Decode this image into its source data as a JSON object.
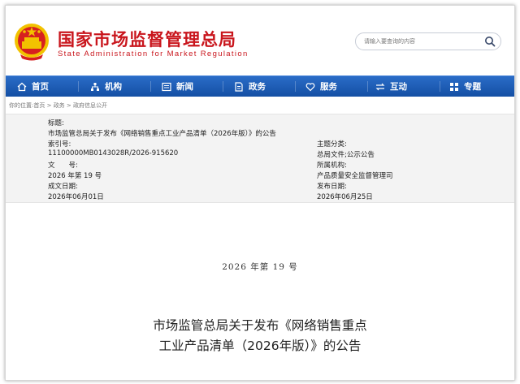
{
  "header": {
    "title": "国家市场监督管理总局",
    "subtitle": "State Administration for Market Regulation",
    "search_placeholder": "请输入要查询的内容"
  },
  "nav": {
    "items": [
      {
        "label": "首页",
        "icon": "home-icon"
      },
      {
        "label": "机构",
        "icon": "org-icon"
      },
      {
        "label": "新闻",
        "icon": "news-icon"
      },
      {
        "label": "政务",
        "icon": "gov-icon"
      },
      {
        "label": "服务",
        "icon": "heart-icon"
      },
      {
        "label": "互动",
        "icon": "exchange-icon"
      },
      {
        "label": "专题",
        "icon": "grid-icon"
      }
    ]
  },
  "breadcrumb": {
    "prefix": "你的位置:",
    "items": [
      "首页",
      "政务",
      "政府信息公开"
    ],
    "separator": " > "
  },
  "meta": {
    "title_label": "标题:",
    "title_value": "市场监管总局关于发布《网络销售重点工业产品清单（2026年版）》的公告",
    "index_label": "索引号:",
    "index_value": "11100000MB0143028R/2026-915620",
    "category_label": "主题分类:",
    "category_value": "总局文件;公示公告",
    "docno_label": "文　　号:",
    "docno_value": "2026 年第 19 号",
    "agency_label": "所属机构:",
    "agency_value": "产品质量安全监督管理司",
    "created_label": "成文日期:",
    "created_value": "2026年06月01日",
    "published_label": "发布日期:",
    "published_value": "2026年06月25日"
  },
  "document": {
    "number": "2026 年第 19 号",
    "title_line1": "市场监管总局关于发布《网络销售重点",
    "title_line2": "工业产品清单（2026年版）》的公告"
  },
  "colors": {
    "brand_red": "#c9161d",
    "nav_blue": "#1a57ae",
    "emblem_gold": "#f2c200"
  }
}
